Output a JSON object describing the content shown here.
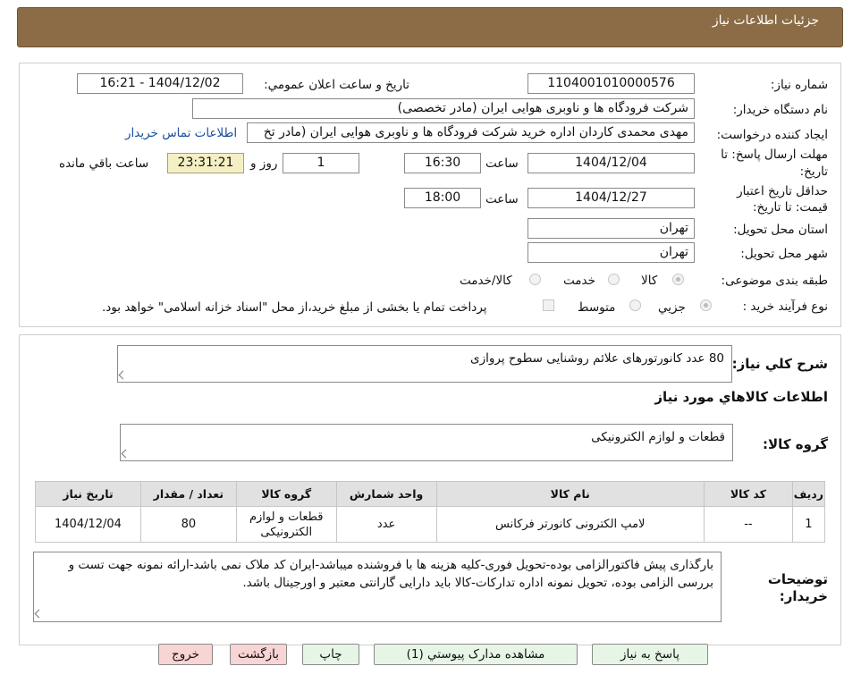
{
  "header": {
    "title": "جزئیات اطلاعات نیاز"
  },
  "form": {
    "need_number_label": "شماره نیاز:",
    "need_number": "1104001010000576",
    "announce_label": "تاریخ و ساعت اعلان عمومي:",
    "announce_value": "1404/12/02 - 16:21",
    "buyer_org_label": "نام دستگاه خریدار:",
    "buyer_org": "شرکت فرودگاه ها و ناوبری هوایی ایران (مادر تخصصی)",
    "requester_label": "ایجاد کننده درخواست:",
    "requester": "مهدی محمدی کاردان اداره خرید شرکت فرودگاه ها و ناوبری هوایی ایران (مادر تخ",
    "contact_link": "اطلاعات تماس خریدار",
    "deadline_label_1": "مهلت ارسال پاسخ: تا",
    "deadline_label_2": "تاریخ:",
    "deadline_date": "1404/12/04",
    "time_label": "ساعت",
    "deadline_time": "16:30",
    "days_value": "1",
    "days_label": "روز و",
    "remaining_time": "23:31:21",
    "remaining_label": "ساعت باقي مانده",
    "validity_label_1": "حداقل تاریخ اعتبار",
    "validity_label_2": "قیمت: تا تاریخ:",
    "validity_date": "1404/12/27",
    "validity_time": "18:00",
    "province_label": "استان محل تحویل:",
    "province": "تهران",
    "city_label": "شهر محل تحویل:",
    "city": "تهران",
    "category_label": "طبقه بندی موضوعی:",
    "category_options": [
      "کالا",
      "خدمت",
      "کالا/خدمت"
    ],
    "process_label": "نوع فرآیند خرید :",
    "process_options": [
      "جزیي",
      "متوسط"
    ],
    "payment_note": "پرداخت تمام یا بخشی از مبلغ خرید،از محل \"اسناد خزانه اسلامی\" خواهد بود."
  },
  "summary": {
    "label": "شرح کلي نیاز:",
    "text": "80 عدد کانورتورهای علائم روشنایی سطوح پروازی",
    "goods_info_title": "اطلاعات کالاهاي مورد نياز",
    "group_label": "گروه کالا:",
    "group_text": "قطعات و لوازم الکترونیکی"
  },
  "table": {
    "headers": [
      "ردیف",
      "کد کالا",
      "نام کالا",
      "واحد شمارش",
      "گروه کالا",
      "تعداد / مقدار",
      "تاریخ نیاز"
    ],
    "rows": [
      [
        "1",
        "--",
        "لامپ الکترونی کانورتر فرکانس",
        "عدد",
        "قطعات و لوازم الکترونیکی",
        "80",
        "1404/12/04"
      ]
    ]
  },
  "notes": {
    "label_1": "توضیحات",
    "label_2": "خریدار:",
    "text": "بارگذاری پیش فاکتورالزامی بوده-تحویل فوری-کلیه هزینه ها با فروشنده میباشد-ایران کد ملاک نمی باشد-ارائه نمونه جهت تست و بررسی الزامی بوده، تحویل نمونه اداره تدارکات-کالا باید دارایی گارانتی معتبر و اورجینال باشد."
  },
  "buttons": {
    "reply": "پاسخ به نیاز",
    "attachments": "مشاهده مدارک پیوستي (1)",
    "print": "چاپ",
    "back": "بازگشت",
    "exit": "خروج"
  },
  "watermark": {
    "text": "AriaTender.neT"
  },
  "colors": {
    "header_bg": "#8b6c46",
    "remaining_bg": "#f5f0c4",
    "back_btn": "#f8d4d4",
    "green_btn": "#e6f5e6",
    "link": "#1a4fa0"
  }
}
